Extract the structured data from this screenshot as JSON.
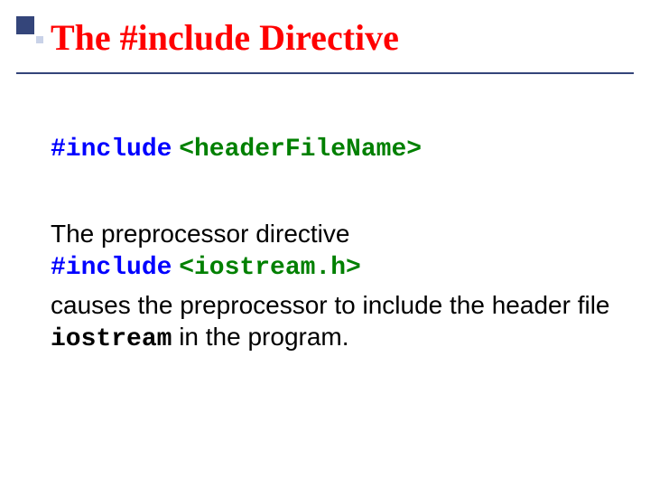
{
  "title": "The #include Directive",
  "syntax": {
    "keyword": "#include",
    "arg": "<headerFileName>"
  },
  "body": {
    "line1": "The preprocessor directive",
    "example_kw": "#include",
    "example_arg": "<iostream.h>",
    "line2a": "causes the preprocessor to include the header file ",
    "inline_code": "iostream",
    "line2b": " in the program."
  }
}
